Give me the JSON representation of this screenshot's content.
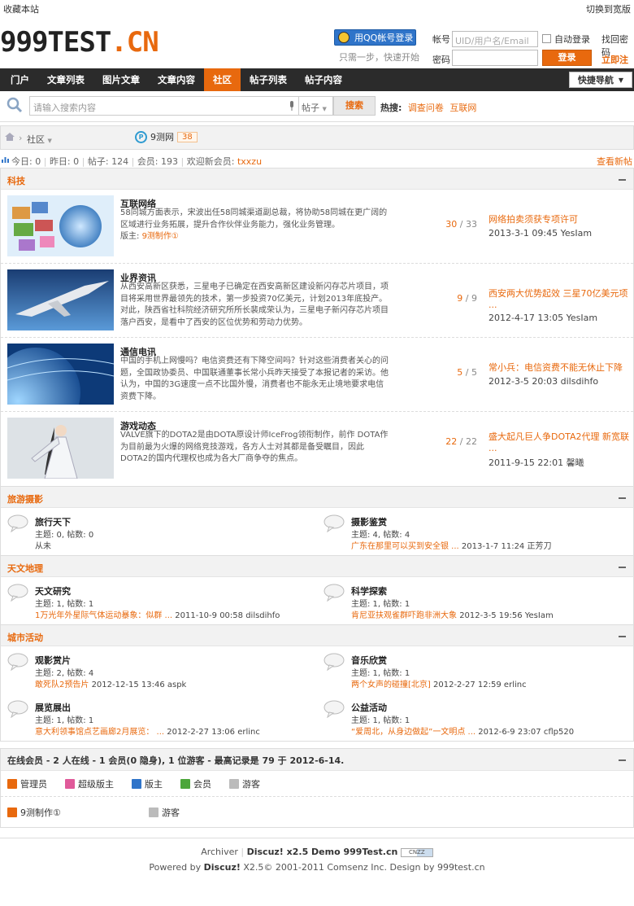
{
  "topbar": {
    "left": "收藏本站",
    "right": "切换到宽版"
  },
  "header": {
    "logo_main": "999TEST",
    "logo_dot": ".CN",
    "qq_login": "用QQ帐号登录",
    "qq_hint": "只需一步，快速开始",
    "account_label": "帐号",
    "account_placeholder": "UID/用户名/Email",
    "auto_login": "自动登录",
    "find_password": "找回密码",
    "password_label": "密码",
    "login": "登录",
    "register": "立即注册"
  },
  "nav": {
    "items": [
      {
        "label": "门户"
      },
      {
        "label": "文章列表"
      },
      {
        "label": "图片文章"
      },
      {
        "label": "文章内容"
      },
      {
        "label": "社区",
        "active": true
      },
      {
        "label": "帖子列表"
      },
      {
        "label": "帖子内容"
      }
    ],
    "quick_nav": "快捷导航"
  },
  "search": {
    "placeholder": "请输入搜索内容",
    "type": "帖子",
    "button": "搜索",
    "hot_label": "热搜:",
    "hot": [
      "调查问卷",
      "互联网"
    ]
  },
  "breadcrumb": {
    "item": "社区",
    "site": "9测网",
    "count": "38"
  },
  "stats": {
    "today_label": "今日:",
    "today": "0",
    "yesterday_label": "昨日:",
    "yesterday": "0",
    "posts_label": "帖子:",
    "posts": "124",
    "members_label": "会员:",
    "members": "193",
    "welcome": "欢迎新会员:",
    "new_member": "txxzu",
    "view_new": "查看新帖"
  },
  "sections": {
    "tech": {
      "title": "科技",
      "forums": [
        {
          "name": "互联网络",
          "desc": "58同城方面表示，宋波出任58同城渠道副总裁，将协助58同城在更广阔的区域进行业务拓展，提升合作伙伴业务能力，强化业务管理。",
          "mod_label": "版主:",
          "mod": "9测制作①",
          "threads": "30",
          "posts": "33",
          "last_title": "网络拍卖须获专项许可",
          "last_meta": "2013-3-1 09:45 YesIam"
        },
        {
          "name": "业界资讯",
          "desc": "从西安高新区获悉，三星电子已确定在西安高新区建设新闪存芯片项目，项目将采用世界最领先的技术，第一步投资70亿美元，计划2013年底投产。对此，陕西省社科院经济研究所所长裴成荣认为，三星电子新闪存芯片项目落户西安，是看中了西安的区位优势和劳动力优势。",
          "threads": "9",
          "posts": "9",
          "last_title": "西安两大优势起效 三星70亿美元项 ...",
          "last_meta": "2012-4-17 13:05 YesIam"
        },
        {
          "name": "通信电讯",
          "desc": "中国的手机上网慢吗？电信资费还有下降空间吗？针对这些消费者关心的问题，全国政协委员、中国联通董事长常小兵昨天接受了本报记者的采访。他认为，中国的3G速度一点不比国外慢，消费者也不能永无止境地要求电信资费下降。",
          "threads": "5",
          "posts": "5",
          "last_title": "常小兵：电信资费不能无休止下降",
          "last_meta": "2012-3-5 20:03 dilsdihfo"
        },
        {
          "name": "游戏动态",
          "desc": "VALVE旗下的DOTA2是由DOTA原设计师IceFrog领衔制作，前作 DOTA作为目前最为火爆的网络竞技游戏，各方人士对其都是备受瞩目，因此DOTA2的国内代理权也成为各大厂商争夺的焦点。",
          "threads": "22",
          "posts": "22",
          "last_title": "盛大起凡巨人争DOTA2代理 新宽联 ...",
          "last_meta": "2011-9-15 22:01 馨曦"
        }
      ]
    },
    "travel": {
      "title": "旅游摄影",
      "forums": [
        {
          "name": "旅行天下",
          "counts": "主题: 0, 帖数: 0",
          "last_title": "",
          "last_meta": "从未"
        },
        {
          "name": "摄影鉴赏",
          "counts": "主题: 4, 帖数: 4",
          "last_title": "广东在那里可以买到安全银 ...",
          "last_meta": "2013-1-7 11:24 正芳刀"
        }
      ]
    },
    "astro": {
      "title": "天文地理",
      "forums": [
        {
          "name": "天文研究",
          "counts": "主题: 1, 帖数: 1",
          "last_title": "1万光年外星际气体运动暴象：似群 ...",
          "last_meta": "2011-10-9 00:58 dilsdihfo"
        },
        {
          "name": "科学探索",
          "counts": "主题: 1, 帖数: 1",
          "last_title": "肯尼亚扶观雀群吓跑非洲大象",
          "last_meta": "2012-3-5 19:56 YesIam"
        }
      ]
    },
    "city": {
      "title": "城市活动",
      "forums": [
        {
          "name": "观影赏片",
          "counts": "主题: 2, 帖数: 4",
          "last_title": "敢死队2预告片",
          "last_meta": "2012-12-15 13:46 aspk"
        },
        {
          "name": "音乐欣赏",
          "counts": "主题: 1, 帖数: 1",
          "last_title": "两个女声的碰撞[北京]",
          "last_meta": "2012-2-27 12:59 erlinc"
        },
        {
          "name": "展览展出",
          "counts": "主题: 1, 帖数: 1",
          "last_title": "意大利领事馆点艺画廊2月展览： ...",
          "last_meta": "2012-2-27 13:06 erlinc"
        },
        {
          "name": "公益活动",
          "counts": "主题: 1, 帖数: 1",
          "last_title": "“爱周北，从身边做起”一文明点 ...",
          "last_meta": "2012-6-9 23:07 cflp520"
        }
      ]
    }
  },
  "online": {
    "summary": "在线会员 - 2 人在线 - 1 会员(0 隐身), 1 位游客 - 最高记录是 79 于 2012-6-14.",
    "legend": [
      {
        "label": "管理员",
        "color": "#e8690e"
      },
      {
        "label": "超级版主",
        "color": "#e05a9a"
      },
      {
        "label": "版主",
        "color": "#2f74c9"
      },
      {
        "label": "会员",
        "color": "#4ca63a"
      },
      {
        "label": "游客",
        "color": "#bbbbbb"
      }
    ],
    "users": [
      {
        "label": "9测制作①",
        "color": "#e8690e"
      },
      {
        "label": "游客",
        "color": "#bbbbbb"
      }
    ]
  },
  "footer": {
    "archiver": "Archiver",
    "product": "Discuz! x2.5 Demo 999Test.cn",
    "cnzz": "CNZZ",
    "powered_pre": "Powered by",
    "powered_brand": "Discuz!",
    "powered_post": "X2.5© 2001-2011 Comsenz Inc. Design by 999test.cn"
  }
}
